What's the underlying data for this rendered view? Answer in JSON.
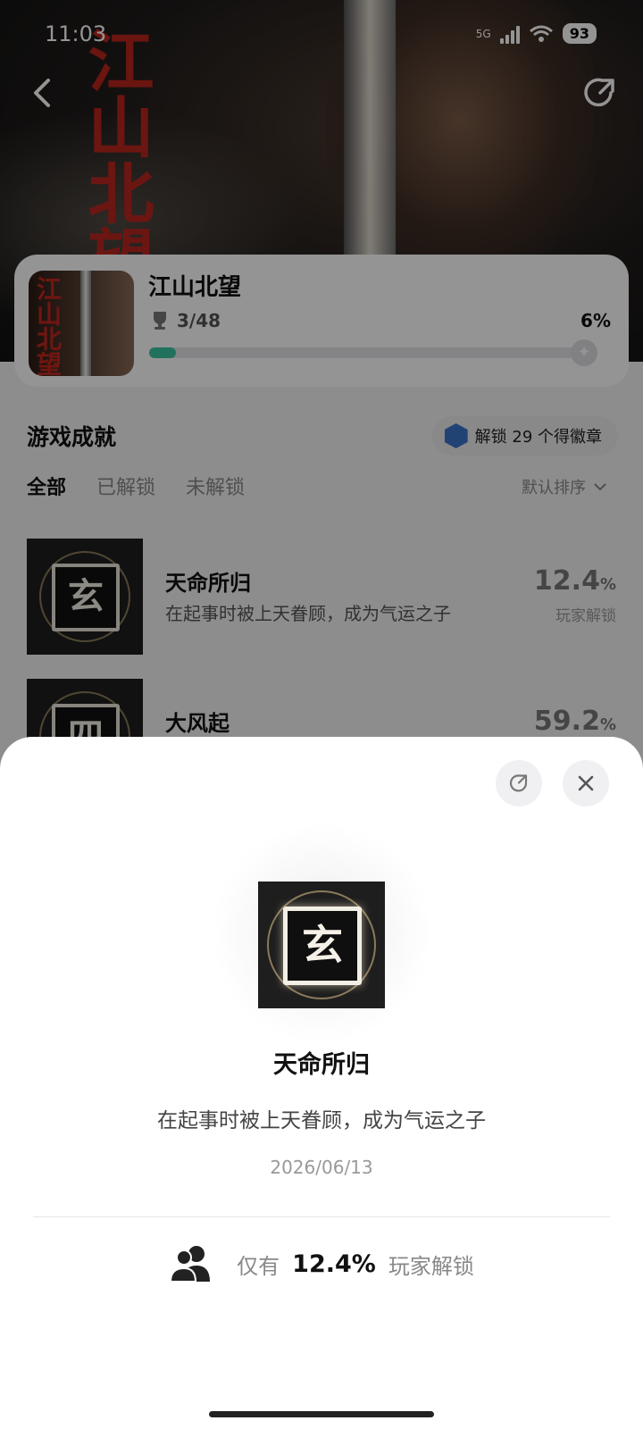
{
  "status": {
    "time": "11:03",
    "network": "5G",
    "battery": "93"
  },
  "game": {
    "title": "江山北望",
    "logo_text": "江山北望",
    "trophy_count": "3/48",
    "progress_label": "6%",
    "progress": 0.06
  },
  "achievements": {
    "section_title": "游戏成就",
    "badge_pill": "解锁 29 个得徽章",
    "tabs": [
      {
        "label": "全部",
        "active": true
      },
      {
        "label": "已解锁",
        "active": false
      },
      {
        "label": "未解锁",
        "active": false
      }
    ],
    "sort_label": "默认排序",
    "items": [
      {
        "name": "天命所归",
        "description": "在起事时被上天眷顾，成为气运之子",
        "percent": "12.4",
        "percent_sign": "%",
        "sub": "玩家解锁",
        "glyph": "玄"
      },
      {
        "name": "大风起",
        "description": "",
        "percent": "59.2",
        "percent_sign": "%",
        "sub": "",
        "glyph": "四"
      }
    ]
  },
  "sheet": {
    "glyph": "玄",
    "title": "天命所归",
    "description": "在起事时被上天眷顾，成为气运之子",
    "date": "2026/06/13",
    "rarity_prefix": "仅有",
    "rarity_value": "12.4%",
    "rarity_suffix": "玩家解锁"
  },
  "colors": {
    "progress": "#3ac4a0",
    "accent_red": "#c0261e",
    "badge_blue": "#3a74c8"
  },
  "icons": [
    "back-icon",
    "share-icon",
    "trophy-icon",
    "badge-icon",
    "chevron-down-icon",
    "close-icon",
    "users-icon"
  ]
}
